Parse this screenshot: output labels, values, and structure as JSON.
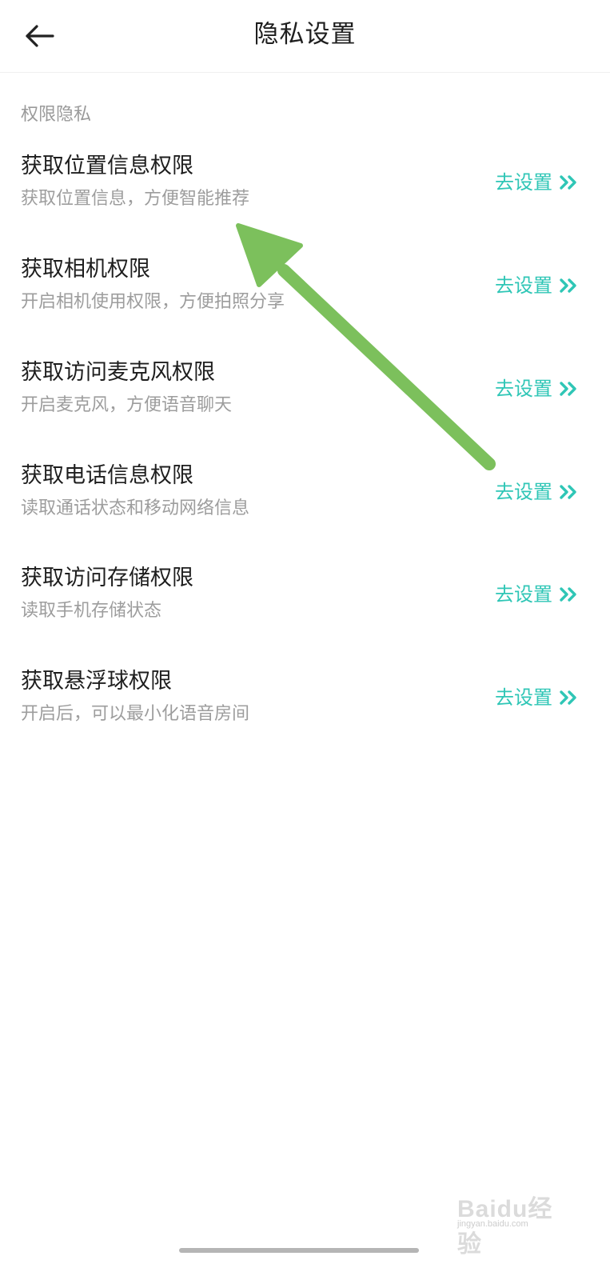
{
  "header": {
    "title": "隐私设置",
    "back_icon": "back-arrow-icon"
  },
  "section": {
    "title": "权限隐私"
  },
  "items": [
    {
      "title": "获取位置信息权限",
      "subtitle": "获取位置信息，方便智能推荐",
      "action": "去设置"
    },
    {
      "title": "获取相机权限",
      "subtitle": "开启相机使用权限，方便拍照分享",
      "action": "去设置"
    },
    {
      "title": "获取访问麦克风权限",
      "subtitle": "开启麦克风，方便语音聊天",
      "action": "去设置"
    },
    {
      "title": "获取电话信息权限",
      "subtitle": "读取通话状态和移动网络信息",
      "action": "去设置"
    },
    {
      "title": "获取访问存储权限",
      "subtitle": "读取手机存储状态",
      "action": "去设置"
    },
    {
      "title": "获取悬浮球权限",
      "subtitle": "开启后，可以最小化语音房间",
      "action": "去设置"
    }
  ],
  "watermark": {
    "brand": "Baidu经验",
    "url": "jingyan.baidu.com"
  },
  "colors": {
    "accent": "#2fc6b6",
    "annotation_arrow": "#7cc05c"
  }
}
